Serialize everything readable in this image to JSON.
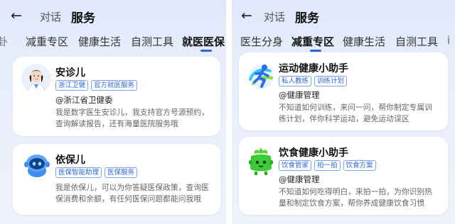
{
  "left": {
    "nav": {
      "back_icon": "arrow-left-icon",
      "dialog": "对话",
      "service": "服务"
    },
    "tabs": [
      "卦",
      "减重专区",
      "健康生活",
      "自测工具",
      "就医医保"
    ],
    "active_tab": 4,
    "cards": [
      {
        "name": "安诊儿",
        "tags": [
          "浙江卫健",
          "官方就医服务"
        ],
        "org": "@浙江省卫健委",
        "desc_lines": [
          "我是数字医生安诊儿，我支持官方号源预约，",
          "查询解读报告，还有海量医院服务哦"
        ],
        "avatar_icon": "doctor-avatar-icon"
      },
      {
        "name": "依保儿",
        "tags": [
          "医保智能助理",
          "医保服务"
        ],
        "org": "",
        "desc_lines": [
          "我是依保儿，可以为你答疑医保政策，查询医",
          "保消费和余额，有任何医保问题都能问我哦"
        ],
        "avatar_icon": "robot-avatar-icon"
      }
    ]
  },
  "right": {
    "nav": {
      "back_icon": "arrow-left-icon",
      "dialog": "对话",
      "service": "服务"
    },
    "tabs": [
      "医生分身",
      "减重专区",
      "健康生活",
      "自测工具",
      "i"
    ],
    "active_tab": 1,
    "cards": [
      {
        "name": "运动健康小助手",
        "tags": [
          "私人教练",
          "训练计划"
        ],
        "org": "@健康管理",
        "desc_lines": [
          "不知道如何训练，来问一问，帮你制定专属训",
          "练计划，伴你科学运动，避免运动误区"
        ],
        "avatar_icon": "sport-runner-icon"
      },
      {
        "name": "饮食健康小助手",
        "tags": [
          "饮食管家",
          "拍一拍",
          "饮食方案"
        ],
        "org": "@健康管理",
        "desc_lines": [
          "不知道如何吃得明白，来拍一拍，为你识别热",
          "量和制定饮食方案，帮你养成健康饮食习惯"
        ],
        "avatar_icon": "food-sprout-icon"
      }
    ]
  },
  "colors": {
    "accent": "#2e63e6",
    "tag_text": "#2a66d9",
    "tag_border": "#7aa3ea"
  }
}
